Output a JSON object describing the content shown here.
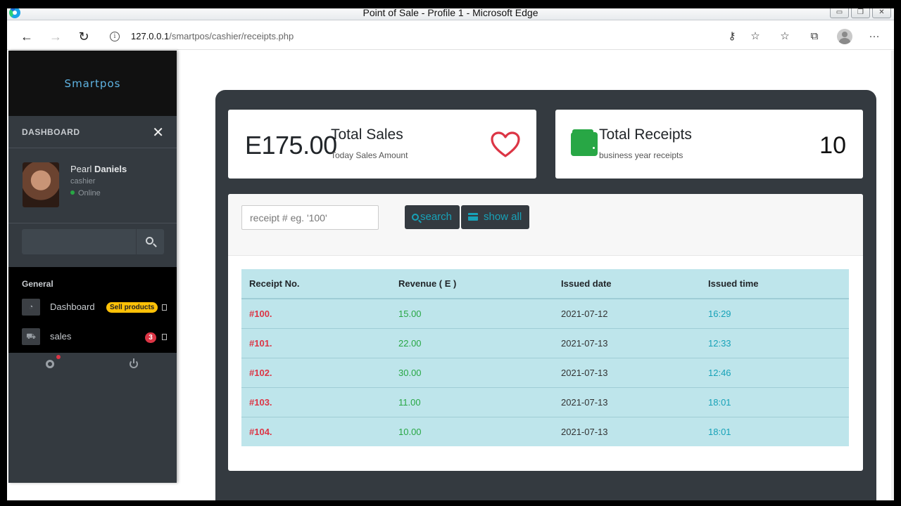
{
  "window": {
    "title": "Point of Sale - Profile 1 - Microsoft Edge",
    "address_host": "127.0.0.1",
    "address_path": "/smartpos/cashier/receipts.php"
  },
  "sidebar": {
    "brand": "Smartpos",
    "section_label": "DASHBOARD",
    "user": {
      "first_name": "Pearl",
      "last_name": "Daniels",
      "role": "cashier",
      "status": "Online"
    },
    "menu_heading": "General",
    "items": [
      {
        "label": "Dashboard",
        "badge": "Sell products"
      },
      {
        "label": "sales",
        "badge": "3"
      }
    ]
  },
  "stats": {
    "sales": {
      "value": "E175.00",
      "title": "Total Sales",
      "subtitle": "Today Sales Amount"
    },
    "receipts": {
      "title": "Total Receipts",
      "subtitle": "business year receipts",
      "count": "10"
    }
  },
  "search": {
    "placeholder": "receipt # eg. '100'",
    "search_label": "search",
    "show_all_label": "show all"
  },
  "table": {
    "headers": [
      "Receipt No.",
      "Revenue ( E )",
      "Issued date",
      "Issued time"
    ],
    "rows": [
      [
        "#100.",
        "15.00",
        "2021-07-12",
        "16:29"
      ],
      [
        "#101.",
        "22.00",
        "2021-07-13",
        "12:33"
      ],
      [
        "#102.",
        "30.00",
        "2021-07-13",
        "12:46"
      ],
      [
        "#103.",
        "11.00",
        "2021-07-13",
        "18:01"
      ],
      [
        "#104.",
        "10.00",
        "2021-07-13",
        "18:01"
      ]
    ]
  },
  "colors": {
    "danger": "#dc3545",
    "success": "#28a745",
    "info": "#17a2b8",
    "dark": "#343a40",
    "table_bg": "#bee5eb"
  }
}
